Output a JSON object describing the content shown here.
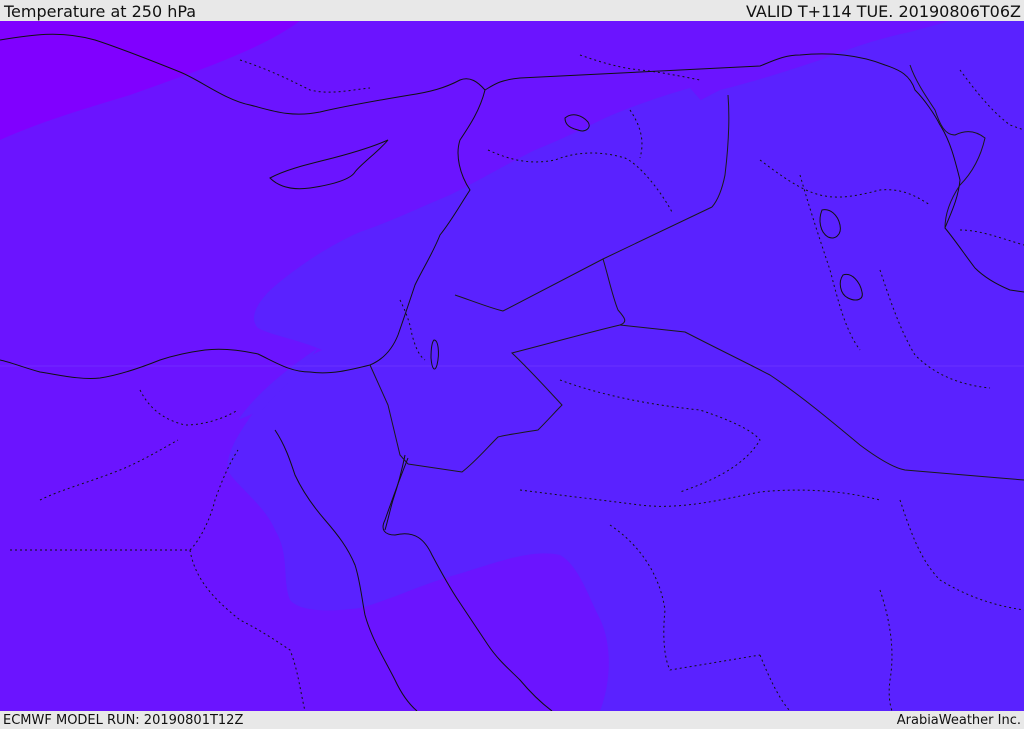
{
  "header": {
    "title": "Temperature at 250 hPa",
    "valid": "VALID T+114 TUE. 20190806T06Z"
  },
  "footer": {
    "model_run": "ECMWF MODEL RUN: 20190801T12Z",
    "credit": "ArabiaWeather Inc."
  },
  "colors": {
    "bg_violet": "#6b14ff",
    "deep_violet": "#8000ff",
    "indigo": "#5a22ff",
    "coast_line": "#111111",
    "border_line": "#1a1a1a"
  }
}
